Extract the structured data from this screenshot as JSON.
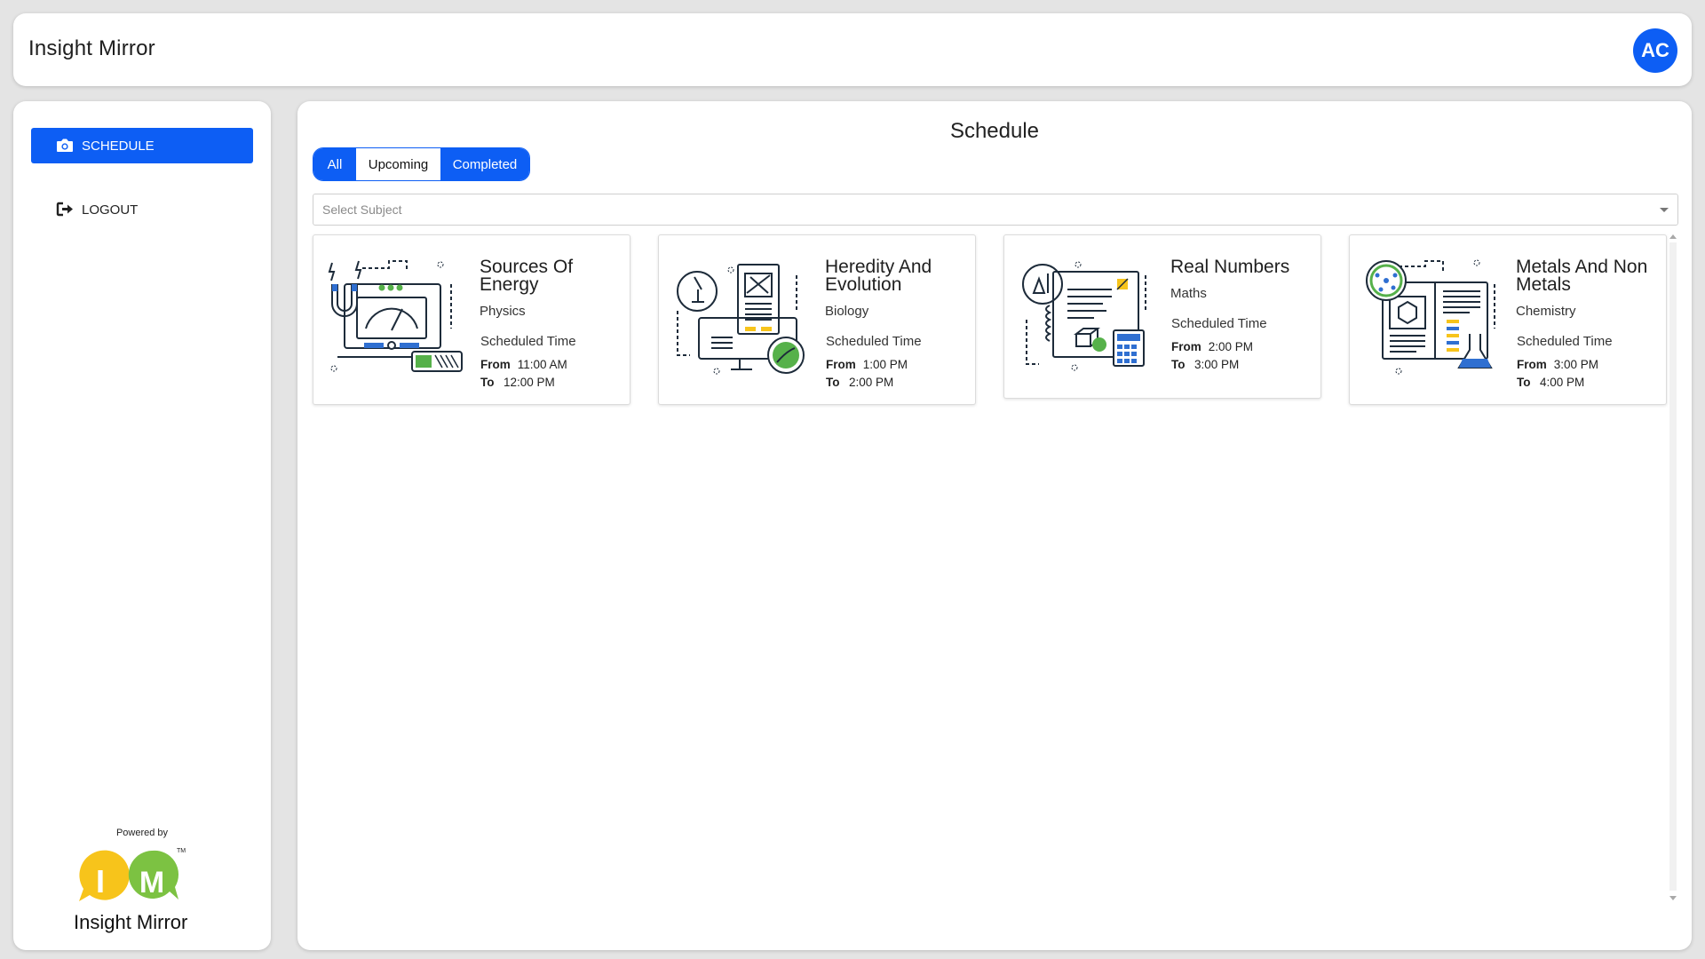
{
  "app": {
    "brand": "Insight Mirror",
    "avatar_initials": "AC",
    "accent_color": "#0d5ef4"
  },
  "sidebar": {
    "items": [
      {
        "label": "SCHEDULE",
        "icon": "camera-icon",
        "active": true
      },
      {
        "label": "LOGOUT",
        "icon": "logout-icon",
        "active": false
      }
    ],
    "powered_by": "Powered by",
    "logo_text": "Insight Mirror",
    "logo_letters": [
      "I",
      "M"
    ],
    "logo_trademark": "TM"
  },
  "main": {
    "title": "Schedule",
    "tabs": [
      {
        "label": "All",
        "active": true
      },
      {
        "label": "Upcoming",
        "active": false
      },
      {
        "label": "Completed",
        "active": true
      }
    ],
    "subject_select": {
      "placeholder": "Select Subject"
    },
    "cards": [
      {
        "title": "Sources Of Energy",
        "subject": "Physics",
        "scheduled_label": "Scheduled Time",
        "from_label": "From",
        "from": "11:00 AM",
        "to_label": "To",
        "to": "12:00 PM",
        "illustration": "physics-illustration-icon"
      },
      {
        "title": "Heredity And Evolution",
        "subject": "Biology",
        "scheduled_label": "Scheduled Time",
        "from_label": "From",
        "from": "1:00 PM",
        "to_label": "To",
        "to": "2:00 PM",
        "illustration": "biology-illustration-icon"
      },
      {
        "title": "Real Numbers",
        "subject": "Maths",
        "scheduled_label": "Scheduled Time",
        "from_label": "From",
        "from": "2:00 PM",
        "to_label": "To",
        "to": "3:00 PM",
        "illustration": "maths-illustration-icon"
      },
      {
        "title": "Metals And Non Metals",
        "subject": "Chemistry",
        "scheduled_label": "Scheduled Time",
        "from_label": "From",
        "from": "3:00 PM",
        "to_label": "To",
        "to": "4:00 PM",
        "illustration": "chemistry-illustration-icon"
      }
    ]
  }
}
